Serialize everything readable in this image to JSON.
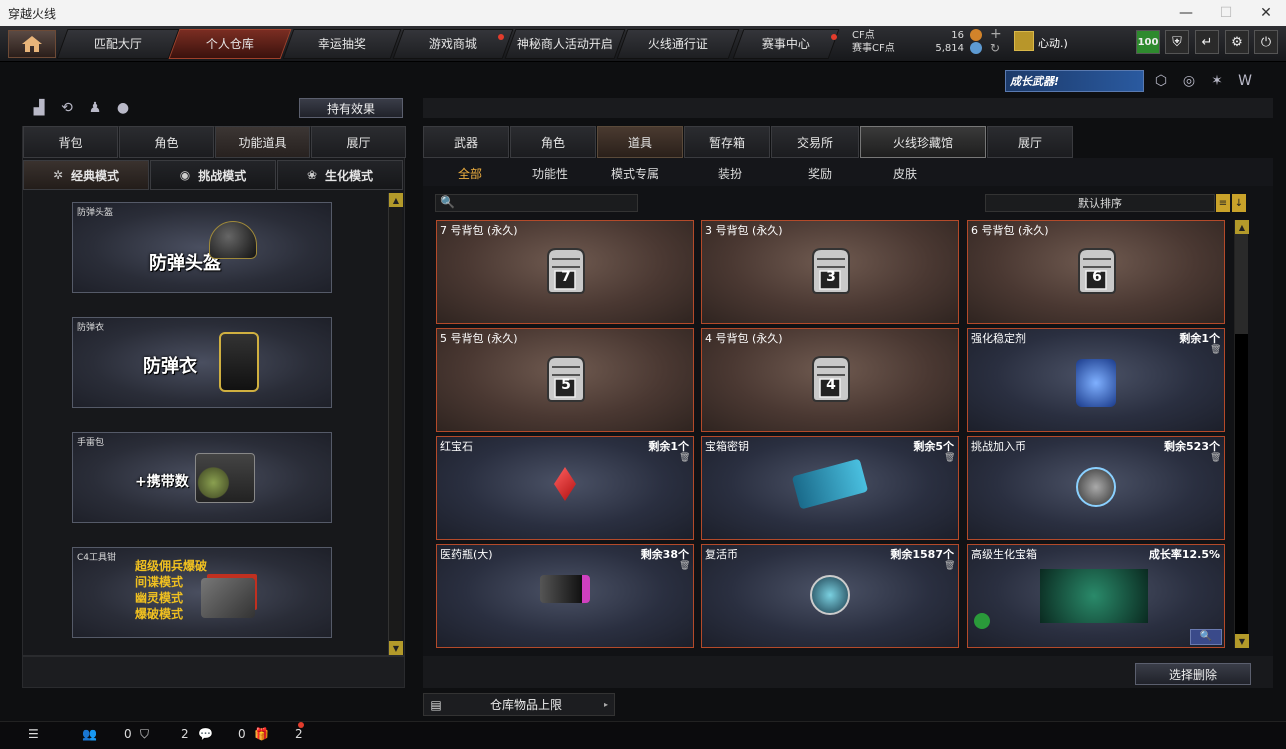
{
  "window": {
    "title": "穿越火线"
  },
  "nav": {
    "tabs": [
      "匹配大厅",
      "个人仓库",
      "幸运抽奖",
      "游戏商城",
      "神秘商人活动开启",
      "火线通行证",
      "赛事中心"
    ],
    "active": "个人仓库"
  },
  "currency": {
    "cf_label": "CF点",
    "cf_value": "16",
    "match_cf_label": "赛事CF点",
    "match_cf_value": "5,814"
  },
  "user": {
    "name": "心动.)",
    "level": "100"
  },
  "promo": {
    "text": "成长武器!"
  },
  "left": {
    "effects_button": "持有效果",
    "tabs": [
      "背包",
      "角色",
      "功能道具",
      "展厅"
    ],
    "active_tab": "功能道具",
    "modes": [
      "经典模式",
      "挑战模式",
      "生化模式"
    ],
    "active_mode": "经典模式",
    "cards": [
      {
        "caption": "防弹头盔",
        "label": "防弹头盔"
      },
      {
        "caption": "防弹衣",
        "label": "防弹衣"
      },
      {
        "caption": "手雷包",
        "label": "+携带数"
      },
      {
        "caption": "C4工具钳",
        "lines": [
          "超级佣兵爆破",
          "间谍模式",
          "幽灵模式",
          "爆破模式"
        ]
      }
    ]
  },
  "right": {
    "tabs": [
      "武器",
      "角色",
      "道具",
      "暂存箱",
      "交易所",
      "火线珍藏馆",
      "展厅"
    ],
    "active_tab": "道具",
    "subtabs": [
      "全部",
      "功能性",
      "模式专属",
      "装扮",
      "奖励",
      "皮肤"
    ],
    "active_subtab": "全部",
    "sort_label": "默认排序",
    "items": [
      {
        "name": "7 号背包 (永久)",
        "count": "",
        "bag": "7"
      },
      {
        "name": "3 号背包 (永久)",
        "count": "",
        "bag": "3"
      },
      {
        "name": "6 号背包 (永久)",
        "count": "",
        "bag": "6"
      },
      {
        "name": "5 号背包 (永久)",
        "count": "",
        "bag": "5"
      },
      {
        "name": "4 号背包 (永久)",
        "count": "",
        "bag": "4"
      },
      {
        "name": "强化稳定剂",
        "count": "剩余1个",
        "bag": ""
      },
      {
        "name": "红宝石",
        "count": "剩余1个",
        "bag": ""
      },
      {
        "name": "宝箱密钥",
        "count": "剩余5个",
        "bag": ""
      },
      {
        "name": "挑战加入币",
        "count": "剩余523个",
        "bag": ""
      },
      {
        "name": "医药瓶(大)",
        "count": "剩余38个",
        "bag": ""
      },
      {
        "name": "复活币",
        "count": "剩余1587个",
        "bag": ""
      },
      {
        "name": "高级生化宝箱",
        "count": "成长率12.5%",
        "bag": ""
      }
    ],
    "delete_button": "选择删除",
    "capacity_label": "仓库物品上限"
  },
  "bottom": {
    "c1": "0",
    "c2": "2",
    "c3": "0",
    "c4": "2"
  }
}
